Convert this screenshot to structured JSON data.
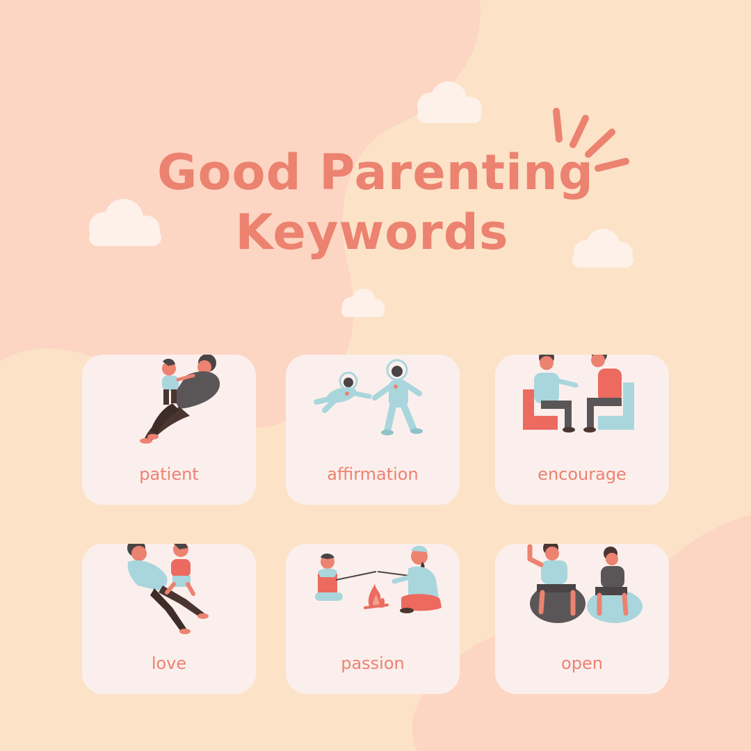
{
  "title": {
    "line1": "Good Parenting",
    "line2": "Keywords"
  },
  "keywords": [
    {
      "label": "patient",
      "art": "parent-lifting-child-illustration"
    },
    {
      "label": "affirmation",
      "art": "astronauts-reaching-illustration"
    },
    {
      "label": "encourage",
      "art": "two-men-talking-seated-illustration"
    },
    {
      "label": "love",
      "art": "parent-holding-child-illustration"
    },
    {
      "label": "passion",
      "art": "campfire-marshmallows-illustration"
    },
    {
      "label": "open",
      "art": "friends-on-beanbags-illustration"
    }
  ],
  "colors": {
    "background": "#fce3c8",
    "blob": "#fdd5c3",
    "accent": "#ec8270",
    "card": "#fbefed",
    "teal": "#a9d6dc",
    "dark": "#4a4446",
    "cloud": "#fdf1ea"
  }
}
